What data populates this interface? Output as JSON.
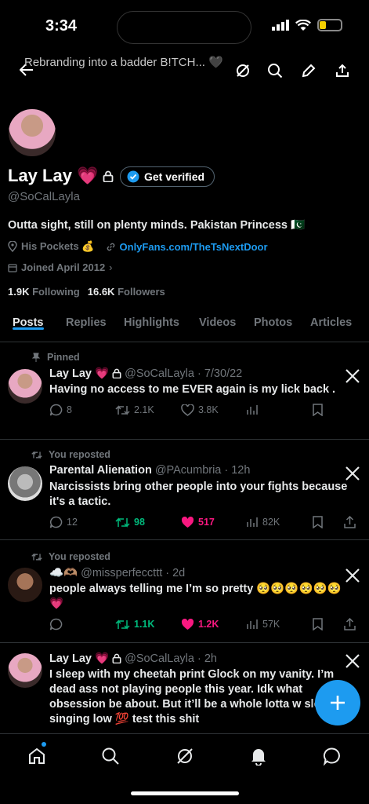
{
  "status_bar": {
    "time": "3:34"
  },
  "header": {
    "title": "Rebranding into a badder B!TCH... 🖤"
  },
  "profile": {
    "name": "Lay Lay",
    "name_emoji": "💗",
    "get_verified": "Get verified",
    "handle": "@SoCalLayla",
    "bio": "Outta sight, still on plenty minds. Pakistan Princess 🇵🇰",
    "location": "His Pockets 💰",
    "website": "OnlyFans.com/TheTsNextDoor",
    "joined": "Joined April 2012",
    "following_count": "1.9K",
    "following_label": "Following",
    "followers_count": "16.6K",
    "followers_label": "Followers"
  },
  "tabs": [
    "Posts",
    "Replies",
    "Highlights",
    "Videos",
    "Photos",
    "Articles"
  ],
  "posts": [
    {
      "context": "Pinned",
      "name": "Lay Lay 💗",
      "handle": "@SoCalLayla",
      "date": "· 7/30/22",
      "text": "Having no access to me EVER again is my lick back .",
      "replies": "8",
      "reposts": "2.1K",
      "likes": "3.8K",
      "views": ""
    },
    {
      "context": "You reposted",
      "name": "Parental Alienation",
      "handle": "@PAcumbria",
      "date": "· 12h",
      "text": "Narcissists bring other people into your fights because it's a tactic.",
      "replies": "12",
      "reposts": "98",
      "likes": "517",
      "views": "82K"
    },
    {
      "context": "You reposted",
      "name": "☁️🫶🏽",
      "handle": "@missperfeccttt",
      "date": "· 2d",
      "text": "people always telling me I’m so pretty 🥺🥺🥺🥺🥺🥺💗",
      "replies": "",
      "reposts": "1.1K",
      "likes": "1.2K",
      "views": "57K"
    },
    {
      "context": "",
      "name": "Lay Lay 💗",
      "handle": "@SoCalLayla",
      "date": "· 2h",
      "text": "I sleep with my cheetah print Glock on my vanity. I’m dead ass not playing people this year. Idk what obsession be about. But it’ll be a whole lotta w slow singing low 💯 test this shit",
      "replies": "",
      "reposts": "",
      "likes": "",
      "views": ""
    }
  ],
  "colors": {
    "accent": "#1d9bf0",
    "repost": "#00ba7c",
    "like": "#f91880",
    "muted": "#71767b"
  }
}
